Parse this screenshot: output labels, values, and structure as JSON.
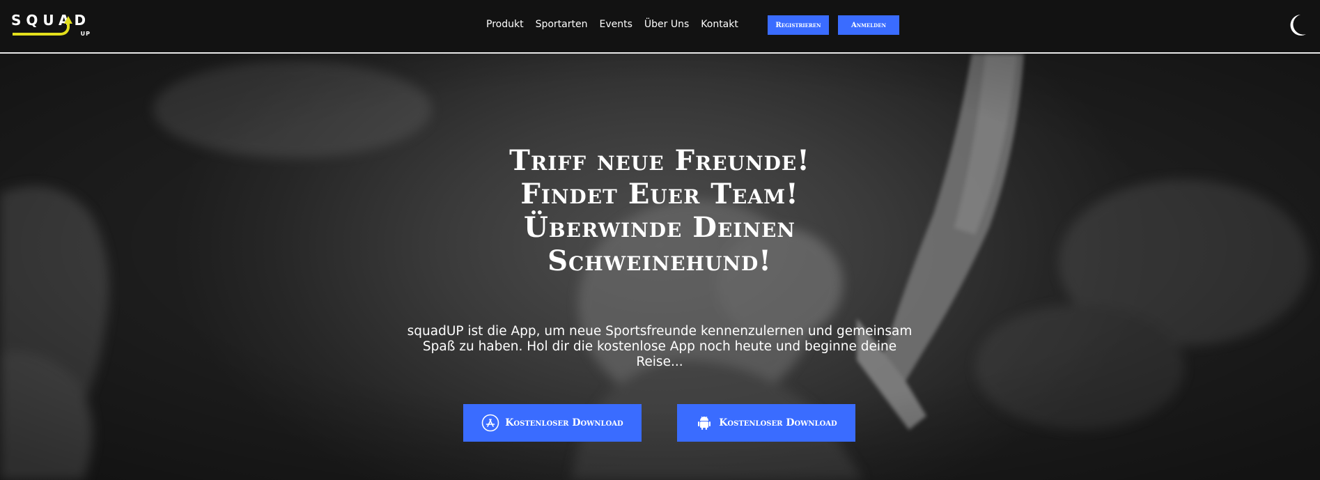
{
  "header": {
    "logo_text": "SQUAD",
    "logo_sub": "UP",
    "nav": [
      {
        "label": "Produkt"
      },
      {
        "label": "Sportarten"
      },
      {
        "label": "Events"
      },
      {
        "label": "Über Uns"
      },
      {
        "label": "Kontakt"
      }
    ],
    "register_label": "Registrieren",
    "login_label": "Anmelden",
    "theme_toggle_icon": "moon-icon"
  },
  "hero": {
    "headline": [
      "Triff neue Freunde!",
      "Findet Euer Team!",
      "Überwinde Deinen",
      "Schweinehund!"
    ],
    "lead": "squadUP ist die App, um neue Sportsfreunde kennenzulernen und gemeinsam Spaß zu haben. Hol dir die kostenlose App noch heute und beginne deine Reise...",
    "buttons": [
      {
        "label": "Kostenloser Download",
        "icon": "app-store-icon"
      },
      {
        "label": "Kostenloser Download",
        "icon": "android-icon"
      }
    ]
  },
  "colors": {
    "accent_blue": "#3a6cff",
    "logo_yellow": "#e3df1c",
    "header_bg": "#121212"
  }
}
